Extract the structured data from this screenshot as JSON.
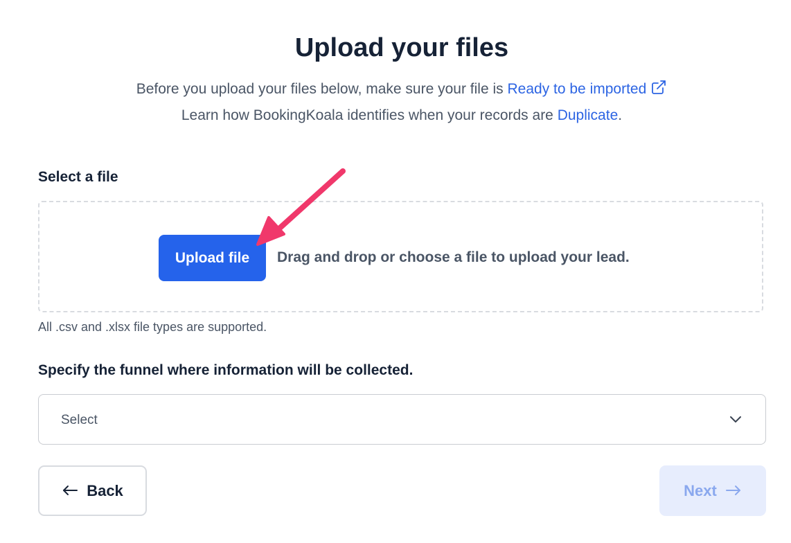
{
  "header": {
    "title": "Upload your files",
    "line1_text": "Before you upload your files below, make sure your file is ",
    "line1_link": "Ready to be imported",
    "line2_text": "Learn how BookingKoala identifies when your records are ",
    "line2_link": "Duplicate",
    "line2_end": "."
  },
  "file_section": {
    "label": "Select a file",
    "upload_button": "Upload file",
    "drop_text": "Drag and drop or choose a file to upload your lead.",
    "hint": "All .csv and .xlsx file types are supported."
  },
  "funnel_section": {
    "label": "Specify the funnel where information will be collected.",
    "selected_value": "Select"
  },
  "footer": {
    "back_label": "Back",
    "next_label": "Next"
  },
  "icons": {
    "external_link": "external-link-icon",
    "chevron": "chevron-down-icon",
    "back_arrow": "arrow-left-icon",
    "next_arrow": "arrow-right-icon",
    "annotation": "pink-arrow-annotation"
  },
  "colors": {
    "accent": "#2563eb",
    "link": "#2c64e3",
    "annotation": "#f0386b",
    "next_disabled_bg": "#e7edfd"
  }
}
